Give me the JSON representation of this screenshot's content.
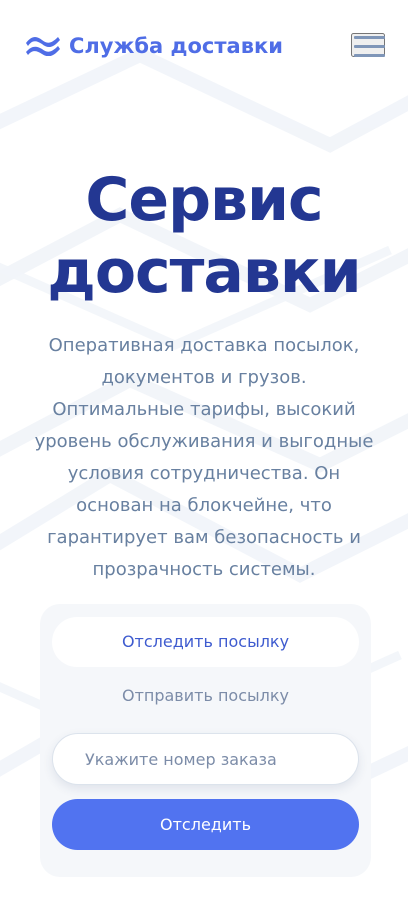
{
  "header": {
    "brand_name": "Служба доставки",
    "logo_icon": "wave-logo-icon",
    "menu_icon": "hamburger-menu-icon"
  },
  "hero": {
    "title_line_1": "Сервис",
    "title_line_2": "доставки",
    "description": "Оперативная доставка посылок, документов и грузов. Оптимальные тарифы, высокий уровень обслуживания и выгодные условия сотрудничества. Он основан на блокчейне, что гарантирует вам безопасность и прозрачность системы."
  },
  "tracking_form": {
    "tabs": [
      {
        "label": "Отследить посылку",
        "active": true
      },
      {
        "label": "Отправить посылку",
        "active": false
      }
    ],
    "order_input": {
      "value": "",
      "placeholder": "Укажите номер заказа"
    },
    "submit_label": "Отследить"
  },
  "colors": {
    "brand": "#4f6de6",
    "title": "#233792",
    "body_text": "#6880a0",
    "button": "#5173f0",
    "card_background": "#f5f7fa"
  }
}
